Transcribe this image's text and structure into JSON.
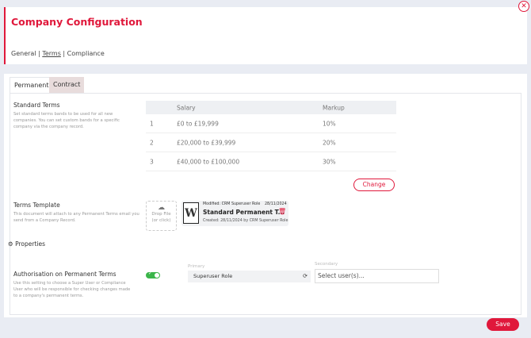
{
  "header": {
    "title": "Company Configuration",
    "breadcrumb": [
      "General",
      "Terms",
      "Compliance"
    ],
    "separator": " | "
  },
  "tabs": [
    {
      "label": "Permanent",
      "active": true
    },
    {
      "label": "Contract",
      "active": false
    }
  ],
  "standard_terms": {
    "title": "Standard Terms",
    "description": "Set standard terms bands to be used for all new companies. You can set custom bands for a specific company via the company record.",
    "columns": [
      "",
      "Salary",
      "Markup"
    ],
    "rows": [
      [
        "1",
        "£0 to £19,999",
        "10%"
      ],
      [
        "2",
        "£20,000 to £39,999",
        "20%"
      ],
      [
        "3",
        "£40,000 to £100,000",
        "30%"
      ]
    ],
    "change_label": "Change"
  },
  "terms_template": {
    "title": "Terms Template",
    "description": "This document will attach to any Permanent Terms email you send from a Company Record.",
    "drop_label": "Drop File",
    "drop_hint": "(or click)",
    "file": {
      "modified": "Modified: CRM Superuser Role",
      "modified_date": "28/11/2024",
      "name": "Standard Permanent T...",
      "created": "Created: 28/11/2024 by CRM Superuser Role"
    }
  },
  "properties": {
    "label": "Properties"
  },
  "authorisation": {
    "title": "Authorisation on Permanent Terms",
    "description": "Use this setting to choose a Super User or Compliance User who will be responsible for checking changes made to a company's permanent terms.",
    "enabled": true,
    "primary_label": "Primary",
    "primary_value": "Superuser Role",
    "secondary_label": "Secondary",
    "secondary_placeholder": "Select user(s)..."
  },
  "save_label": "Save",
  "colors": {
    "accent": "#e0183b",
    "toggle_on": "#3bb54a"
  }
}
